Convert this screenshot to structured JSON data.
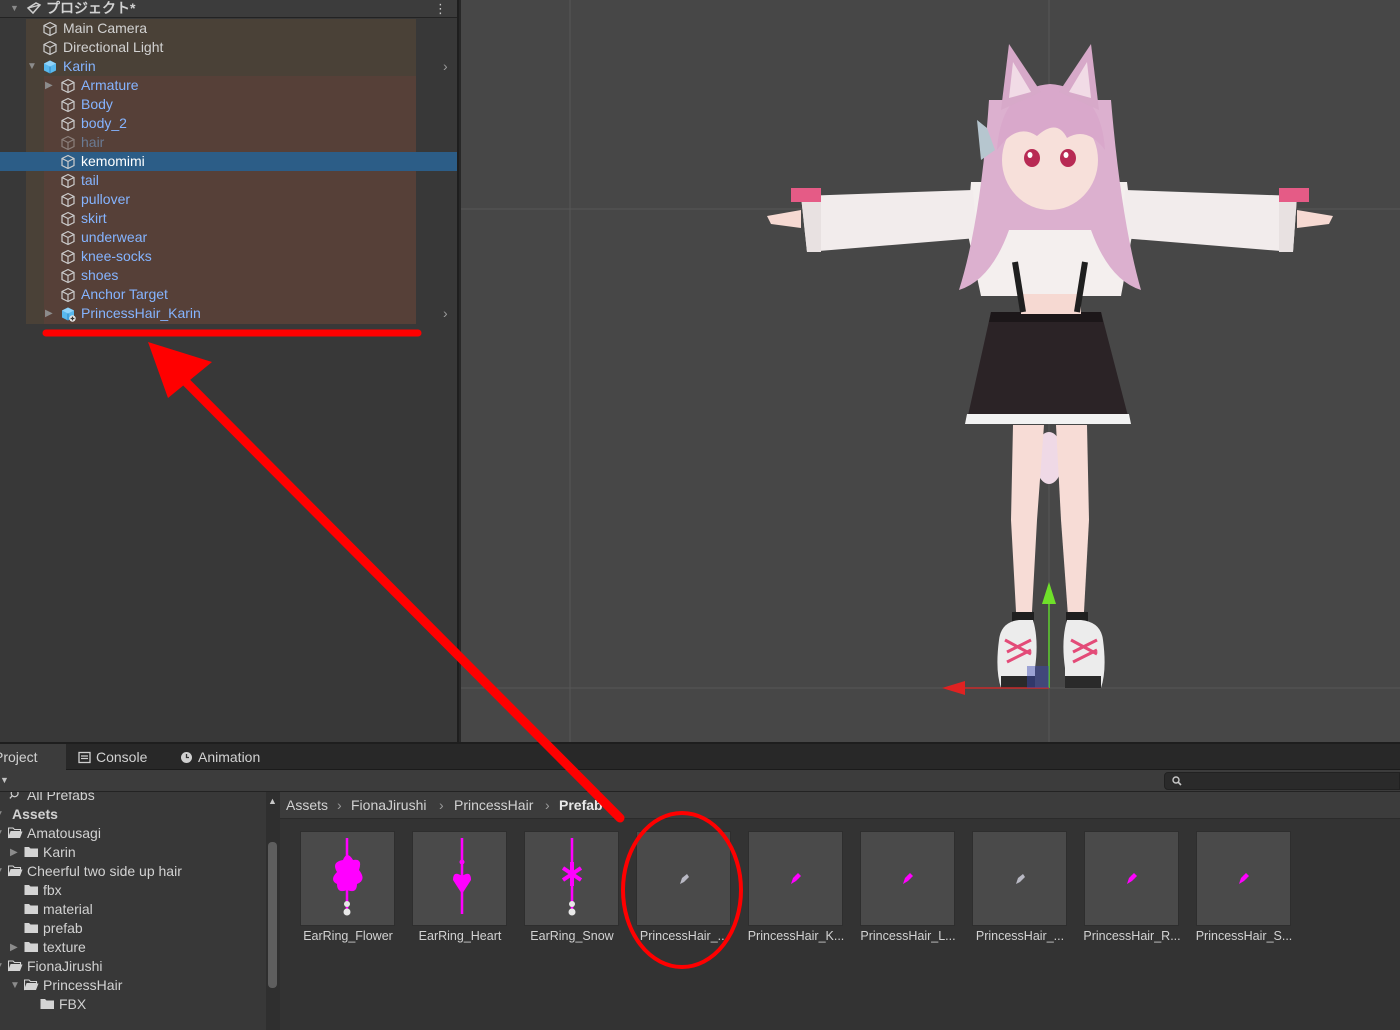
{
  "hierarchy": {
    "scene_title": "プロジェクト*",
    "items": [
      {
        "label": "Main Camera",
        "icon": "gameobject-icon",
        "color": "plain",
        "depth": 1,
        "fold": "",
        "selected": false,
        "more": false
      },
      {
        "label": "Directional Light",
        "icon": "gameobject-icon",
        "color": "plain",
        "depth": 1,
        "fold": "",
        "selected": false,
        "more": false
      },
      {
        "label": "Karin",
        "icon": "prefab-icon",
        "color": "prefab",
        "depth": 1,
        "fold": "open",
        "selected": false,
        "more": true
      },
      {
        "label": "Armature",
        "icon": "gameobject-icon",
        "color": "prefab",
        "depth": 2,
        "fold": "closed",
        "selected": false,
        "more": false
      },
      {
        "label": "Body",
        "icon": "gameobject-icon",
        "color": "prefab",
        "depth": 2,
        "fold": "",
        "selected": false,
        "more": false
      },
      {
        "label": "body_2",
        "icon": "gameobject-icon",
        "color": "prefab",
        "depth": 2,
        "fold": "",
        "selected": false,
        "more": false
      },
      {
        "label": "hair",
        "icon": "gameobject-icon",
        "color": "dim",
        "depth": 2,
        "fold": "",
        "selected": false,
        "more": false
      },
      {
        "label": "kemomimi",
        "icon": "gameobject-icon",
        "color": "white",
        "depth": 2,
        "fold": "",
        "selected": true,
        "more": false
      },
      {
        "label": "tail",
        "icon": "gameobject-icon",
        "color": "prefab",
        "depth": 2,
        "fold": "",
        "selected": false,
        "more": false
      },
      {
        "label": "pullover",
        "icon": "gameobject-icon",
        "color": "prefab",
        "depth": 2,
        "fold": "",
        "selected": false,
        "more": false
      },
      {
        "label": "skirt",
        "icon": "gameobject-icon",
        "color": "prefab",
        "depth": 2,
        "fold": "",
        "selected": false,
        "more": false
      },
      {
        "label": "underwear",
        "icon": "gameobject-icon",
        "color": "prefab",
        "depth": 2,
        "fold": "",
        "selected": false,
        "more": false
      },
      {
        "label": "knee-socks",
        "icon": "gameobject-icon",
        "color": "prefab",
        "depth": 2,
        "fold": "",
        "selected": false,
        "more": false
      },
      {
        "label": "shoes",
        "icon": "gameobject-icon",
        "color": "prefab",
        "depth": 2,
        "fold": "",
        "selected": false,
        "more": false
      },
      {
        "label": "Anchor Target",
        "icon": "gameobject-icon",
        "color": "prefab",
        "depth": 2,
        "fold": "",
        "selected": false,
        "more": false
      },
      {
        "label": "PrincessHair_Karin",
        "icon": "prefab-added-icon",
        "color": "prefab",
        "depth": 2,
        "fold": "closed",
        "selected": false,
        "more": true
      }
    ]
  },
  "tabs": [
    {
      "label": "Project",
      "icon": "folder-icon",
      "active": true
    },
    {
      "label": "Console",
      "icon": "console-icon",
      "active": false
    },
    {
      "label": "Animation",
      "icon": "animation-clock-icon",
      "active": false
    }
  ],
  "search": {
    "placeholder": "",
    "icon": "search-icon"
  },
  "folders": [
    {
      "label": "All Prefabs",
      "depth": 0,
      "fold": "",
      "icon": "search-icon",
      "bold": false
    },
    {
      "label": "Assets",
      "depth": 0,
      "fold": "open",
      "icon": "",
      "bold": true
    },
    {
      "label": "Amatousagi",
      "depth": 0,
      "fold": "open",
      "icon": "folder-open-icon",
      "bold": false
    },
    {
      "label": "Karin",
      "depth": 1,
      "fold": "closed",
      "icon": "folder-icon",
      "bold": false
    },
    {
      "label": "Cheerful two side up hair",
      "depth": 0,
      "fold": "open",
      "icon": "folder-open-icon",
      "bold": false
    },
    {
      "label": "fbx",
      "depth": 1,
      "fold": "",
      "icon": "folder-icon",
      "bold": false
    },
    {
      "label": "material",
      "depth": 1,
      "fold": "",
      "icon": "folder-icon",
      "bold": false
    },
    {
      "label": "prefab",
      "depth": 1,
      "fold": "",
      "icon": "folder-icon",
      "bold": false
    },
    {
      "label": "texture",
      "depth": 1,
      "fold": "closed",
      "icon": "folder-icon",
      "bold": false
    },
    {
      "label": "FionaJirushi",
      "depth": 0,
      "fold": "open",
      "icon": "folder-open-icon",
      "bold": false
    },
    {
      "label": "PrincessHair",
      "depth": 1,
      "fold": "open",
      "icon": "folder-open-icon",
      "bold": false
    },
    {
      "label": "FBX",
      "depth": 2,
      "fold": "",
      "icon": "folder-icon",
      "bold": false
    }
  ],
  "breadcrumb": {
    "items": [
      "Assets",
      "FionaJirushi",
      "PrincessHair"
    ],
    "current": "Prefab"
  },
  "assets": [
    {
      "label": "EarRing_Flower",
      "preview": "earring-flower"
    },
    {
      "label": "EarRing_Heart",
      "preview": "earring-heart"
    },
    {
      "label": "EarRing_Snow",
      "preview": "earring-snow"
    },
    {
      "label": "PrincessHair_...",
      "preview": "hair-grey"
    },
    {
      "label": "PrincessHair_K...",
      "preview": "hair-magenta"
    },
    {
      "label": "PrincessHair_L...",
      "preview": "hair-magenta"
    },
    {
      "label": "PrincessHair_...",
      "preview": "hair-grey"
    },
    {
      "label": "PrincessHair_R...",
      "preview": "hair-magenta"
    },
    {
      "label": "PrincessHair_S...",
      "preview": "hair-magenta"
    }
  ],
  "colors": {
    "selection": "#2c5d87",
    "prefab_text": "#85b4ff",
    "annotation_red": "#ff0000",
    "missing_material_magenta": "#ff00ff"
  }
}
